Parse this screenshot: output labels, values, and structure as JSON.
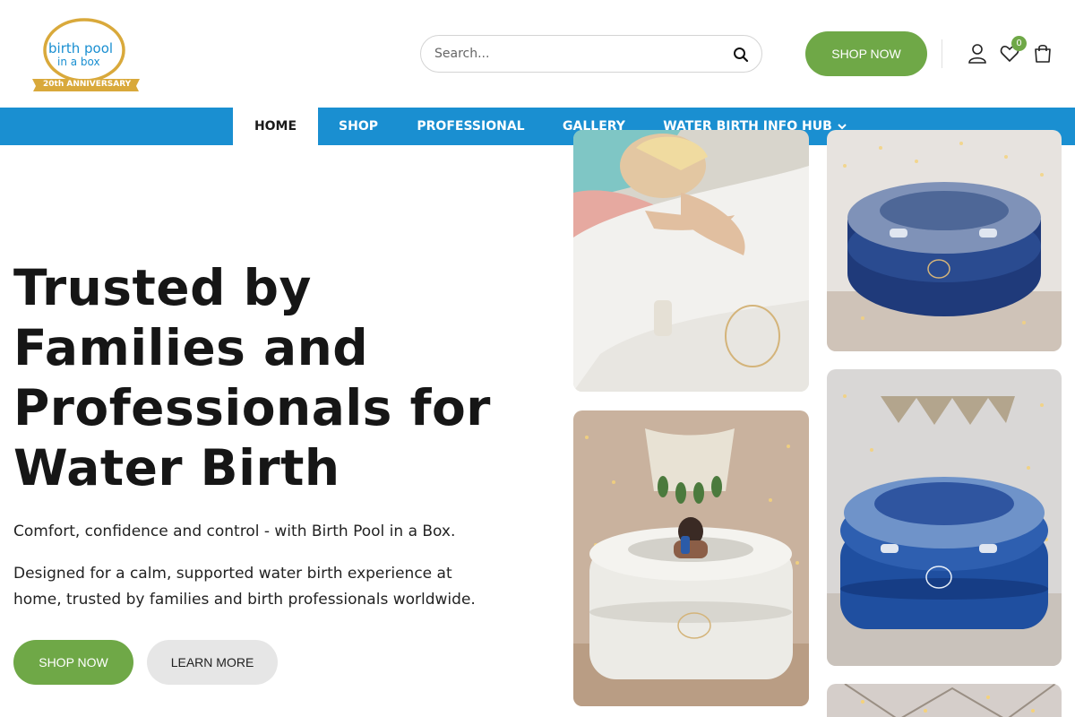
{
  "header": {
    "logo": {
      "line1": "birth pool",
      "line2": "in a box",
      "ribbon": "20th ANNIVERSARY"
    },
    "search": {
      "placeholder": "Search..."
    },
    "shop_now_label": "SHOP NOW",
    "wishlist_count": "0",
    "icons": [
      "search-icon",
      "user-icon",
      "heart-icon",
      "bag-icon"
    ]
  },
  "nav": {
    "items": [
      {
        "label": "HOME",
        "active": true
      },
      {
        "label": "SHOP"
      },
      {
        "label": "PROFESSIONAL"
      },
      {
        "label": "GALLERY"
      },
      {
        "label": "WATER BIRTH INFO HUB",
        "has_dropdown": true
      }
    ]
  },
  "hero": {
    "title_lines": [
      "Trusted by",
      "Families and",
      "Professionals for",
      "Water Birth"
    ],
    "subtitle": "Comfort, confidence and control - with Birth Pool in a Box.",
    "description": "Designed for a calm, supported water birth experience at home, trusted by families and birth professionals worldwide.",
    "primary_button": "SHOP NOW",
    "secondary_button": "LEARN MORE"
  },
  "colors": {
    "brand_blue": "#1a8fd1",
    "brand_green": "#6fa847",
    "logo_gold": "#d9a93b"
  }
}
